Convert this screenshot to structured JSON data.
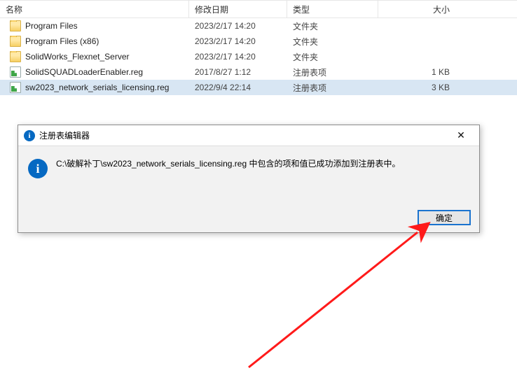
{
  "columns": {
    "name": "名称",
    "date": "修改日期",
    "type": "类型",
    "size": "大小"
  },
  "files": [
    {
      "name": "Program Files",
      "date": "2023/2/17 14:20",
      "type": "文件夹",
      "size": "",
      "icon": "folder"
    },
    {
      "name": "Program Files (x86)",
      "date": "2023/2/17 14:20",
      "type": "文件夹",
      "size": "",
      "icon": "folder"
    },
    {
      "name": "SolidWorks_Flexnet_Server",
      "date": "2023/2/17 14:20",
      "type": "文件夹",
      "size": "",
      "icon": "folder"
    },
    {
      "name": "SolidSQUADLoaderEnabler.reg",
      "date": "2017/8/27 1:12",
      "type": "注册表项",
      "size": "1 KB",
      "icon": "reg"
    },
    {
      "name": "sw2023_network_serials_licensing.reg",
      "date": "2022/9/4 22:14",
      "type": "注册表项",
      "size": "3 KB",
      "icon": "reg",
      "selected": true
    }
  ],
  "dialog": {
    "title": "注册表编辑器",
    "message": "C:\\破解补丁\\sw2023_network_serials_licensing.reg 中包含的项和值已成功添加到注册表中。",
    "ok": "确定"
  }
}
